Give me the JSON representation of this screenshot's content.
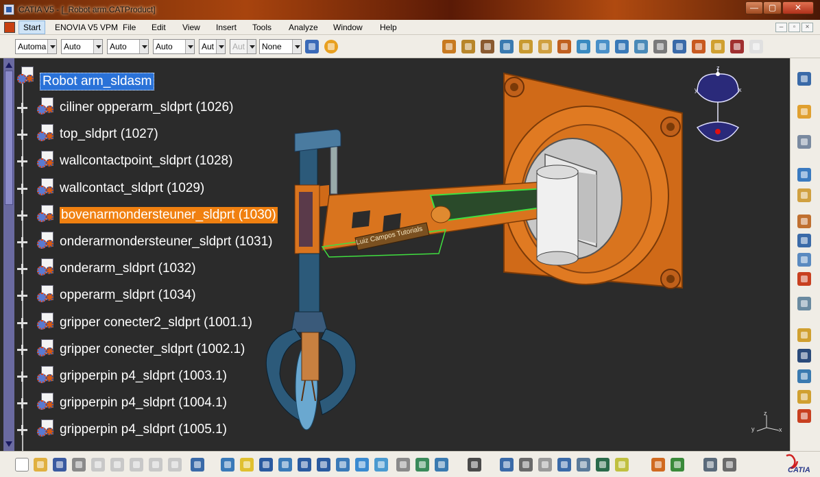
{
  "window": {
    "title": "CATIA V5 - [_Robot arm.CATProduct]",
    "min_label": "—",
    "max_label": "▢",
    "close_label": "✕"
  },
  "menubar": {
    "items": [
      {
        "label": "Start"
      },
      {
        "label": "ENOVIA V5 VPM"
      },
      {
        "label": "File"
      },
      {
        "label": "Edit"
      },
      {
        "label": "View"
      },
      {
        "label": "Insert"
      },
      {
        "label": "Tools"
      },
      {
        "label": "Analyze"
      },
      {
        "label": "Window"
      },
      {
        "label": "Help"
      }
    ],
    "mdi": [
      "–",
      "▫",
      "×"
    ]
  },
  "toolbar": {
    "combos": [
      "Automa",
      "Auto",
      "Auto",
      "Auto",
      "Aut",
      "Aut",
      "None"
    ]
  },
  "tree": {
    "root": "Robot arm_sldasm",
    "nodes": [
      "ciliner opperarm_sldprt (1026)",
      "top_sldprt (1027)",
      "wallcontactpoint_sldprt (1028)",
      "wallcontact_sldprt (1029)",
      "bovenarmondersteuner_sldprt (1030)",
      "onderarmondersteuner_sldprt (1031)",
      "onderarm_sldprt (1032)",
      "opperarm_sldprt (1034)",
      "gripper conecter2_sldprt (1001.1)",
      "gripper conecter_sldprt (1002.1)",
      "gripperpin p4_sldprt (1003.1)",
      "gripperpin p4_sldprt (1004.1)",
      "gripperpin p4_sldprt (1005.1)"
    ],
    "highlighted_index": 4
  },
  "viewport": {
    "watermark": "Luiz Campos Tutorials",
    "compass_x": "x",
    "compass_y": "y",
    "compass_z": "z",
    "axis_x": "x",
    "axis_y": "y",
    "axis_z": "z"
  },
  "logo": {
    "text": "CATIA"
  },
  "colors": {
    "accent_orange": "#f08010",
    "selection_blue": "#2a72d8",
    "part_orange": "#d9741e"
  }
}
